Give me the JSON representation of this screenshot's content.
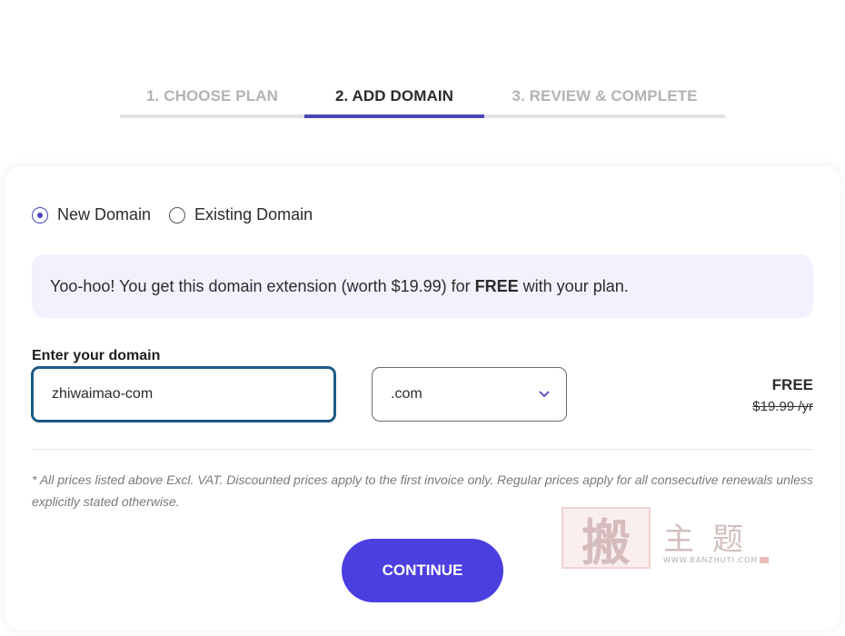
{
  "stepper": {
    "steps": [
      {
        "label": "1. CHOOSE PLAN",
        "state": "done"
      },
      {
        "label": "2. ADD DOMAIN",
        "state": "active"
      },
      {
        "label": "3. REVIEW & COMPLETE",
        "state": "pending"
      }
    ]
  },
  "domain_type": {
    "options": [
      {
        "label": "New Domain",
        "selected": true
      },
      {
        "label": "Existing Domain",
        "selected": false
      }
    ]
  },
  "promo": {
    "text_before": "Yoo-hoo! You get this domain extension (worth $19.99) for ",
    "text_bold": "FREE",
    "text_after": " with your plan."
  },
  "domain_form": {
    "label": "Enter your domain",
    "input_value": "zhiwaimao-com",
    "tld_selected": ".com",
    "price_now": "FREE",
    "price_old": "$19.99 /yr"
  },
  "note": "* All prices listed above Excl. VAT. Discounted prices apply to the first invoice only. Regular prices apply for all consecutive renewals unless explicitly stated otherwise.",
  "continue_label": "CONTINUE",
  "watermark": {
    "seal": "搬",
    "text": "主题",
    "url": "WWW.BANZHUTI.COM"
  },
  "colors": {
    "accent": "#4b47b9",
    "button": "#4b3fe0",
    "promo_bg": "#f5f0fd",
    "input_border": "#1c5a86"
  },
  "icons": {
    "select_arrow": "chevron-down-icon",
    "radio": "radio-icon"
  }
}
